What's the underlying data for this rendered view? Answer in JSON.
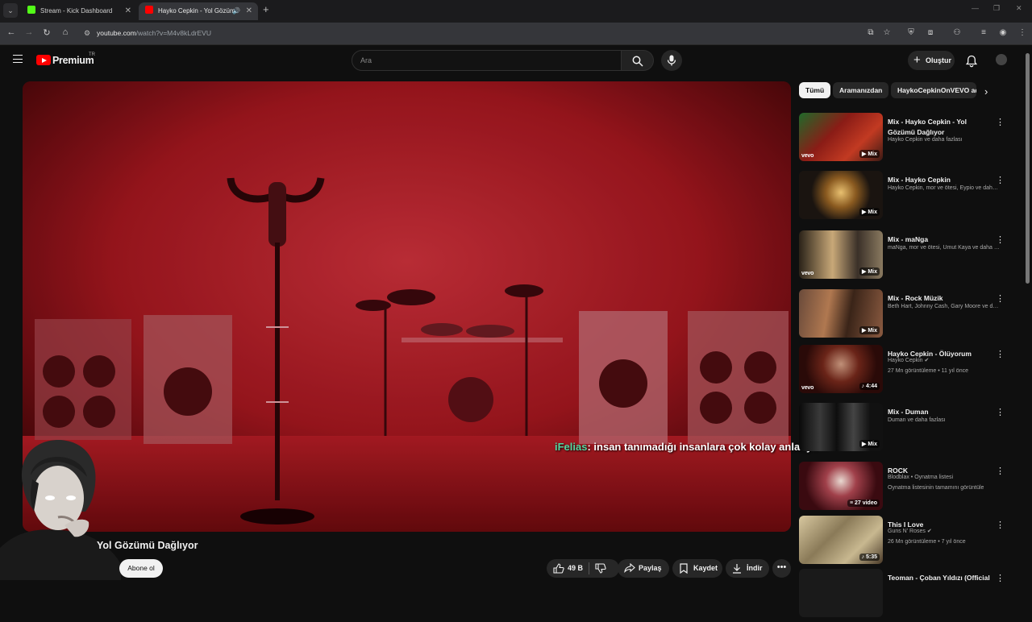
{
  "browser": {
    "tabs": [
      {
        "label": "Stream - Kick Dashboard",
        "favicon_color": "#53fc18"
      },
      {
        "label": "Hayko Cepkin - Yol Gözüm",
        "favicon_color": "#ff0000"
      }
    ],
    "url_main": "youtube.com",
    "url_path": "/watch?v=M4v8kLdrEVU"
  },
  "header": {
    "logo_text": "Premium",
    "logo_region": "TR",
    "search_placeholder": "Ara",
    "create_label": "Oluştur"
  },
  "player": {
    "chat_user": "iFelias",
    "chat_text": ": insan tanımadığı insanlara çok kolay anlatıyo"
  },
  "video": {
    "title": "Yol Gözümü Dağlıyor",
    "subscribe_label": "Abone ol",
    "like_count": "49 B",
    "share_label": "Paylaş",
    "save_label": "Kaydet",
    "download_label": "İndir"
  },
  "chips": [
    "Tümü",
    "Aramanızdan",
    "HaykoCepkinOnVEVO adlı"
  ],
  "recommendations": [
    {
      "title": "Mix - Hayko Cepkin - Yol Gözümü Dağlıyor",
      "meta1": "Hayko Cepkin ve daha fazlası",
      "meta2": "",
      "badge": "Mix",
      "vevo": "vevo",
      "color": "#8a1c16"
    },
    {
      "title": "Mix - Hayko Cepkin",
      "meta1": "Hayko Cepkin, mor ve ötesi, Eypio ve daha fazlası",
      "meta2": "",
      "badge": "Mix",
      "vevo": "",
      "color": "#2e2418"
    },
    {
      "title": "Mix - maNga",
      "meta1": "maNga, mor ve ötesi, Umut Kaya ve daha fazlası",
      "meta2": "",
      "badge": "Mix",
      "vevo": "vevo",
      "color": "#5a4a2e"
    },
    {
      "title": "Mix - Rock Müzik",
      "meta1": "Beth Hart, Johnny Cash, Gary Moore ve daha fazlası",
      "meta2": "",
      "badge": "Mix",
      "vevo": "",
      "color": "#4a2a22"
    },
    {
      "title": "Hayko Cepkin - Ölüyorum",
      "meta1": "Hayko Cepkin",
      "meta2": "27 Mn görüntüleme • 11 yıl önce",
      "badge": "4:44",
      "vevo": "vevo",
      "color": "#3a1814"
    },
    {
      "title": "Mix - Duman",
      "meta1": "Duman ve daha fazlası",
      "meta2": "",
      "badge": "Mix",
      "vevo": "",
      "color": "#1c1c1c"
    },
    {
      "title": "ROCK",
      "meta1": "Blodblax • Oynatma listesi",
      "meta2": "Oynatma listesinin tamamını görüntüle",
      "badge": "27 video",
      "vevo": "",
      "color": "#5a1018"
    },
    {
      "title": "This I Love",
      "meta1": "Guns N' Roses",
      "meta2": "26 Mn görüntüleme • 7 yıl önce",
      "badge": "5:35",
      "vevo": "",
      "color": "#7a6a4a"
    },
    {
      "title": "Teoman - Çoban Yıldızı (Official",
      "meta1": "",
      "meta2": "",
      "badge": "",
      "vevo": "",
      "color": "#222"
    }
  ]
}
